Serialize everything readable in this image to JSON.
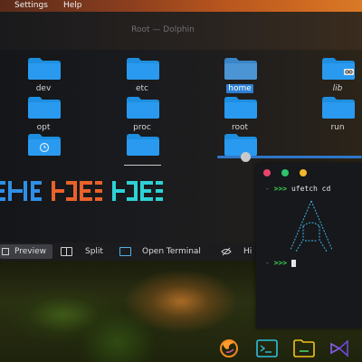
{
  "menubar": {
    "items": [
      "Settings",
      "Help"
    ]
  },
  "window": {
    "title": "Root — Dolphin"
  },
  "folders": [
    {
      "label": "dev",
      "selected": false
    },
    {
      "label": "etc",
      "selected": false
    },
    {
      "label": "home",
      "selected": true
    },
    {
      "label": "lib",
      "selected": false
    },
    {
      "label": "opt",
      "selected": false
    },
    {
      "label": "proc",
      "selected": false
    },
    {
      "label": "root",
      "selected": false
    },
    {
      "label": "run",
      "selected": false
    },
    {
      "label": "",
      "selected": false
    },
    {
      "label": "",
      "selected": false
    },
    {
      "label": "",
      "selected": false
    }
  ],
  "toolbar": {
    "preview_label": "Preview",
    "split_label": "Split",
    "open_terminal_label": "Open Terminal",
    "hidden_label": "Hi"
  },
  "terminal": {
    "prompt_arrows": ">>>",
    "command": "ufetch cd",
    "dash": "-"
  },
  "colors": {
    "folder_blue": "#1e8fe0",
    "selection": "#2d7fd6",
    "prompt_green": "#3ccf4e",
    "glitch_blue": "#2f8fe6",
    "glitch_orange": "#e8622a",
    "glitch_cyan": "#2ed1d6",
    "logo_cyan": "#3ab7e8"
  }
}
